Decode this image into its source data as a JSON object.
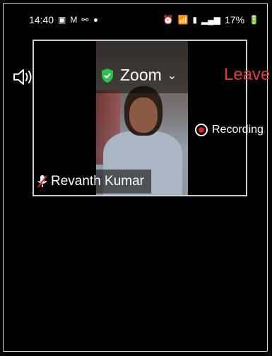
{
  "status_bar": {
    "time": "14:40",
    "battery": "17%",
    "icons": [
      "image-icon",
      "m-icon",
      "app-icon",
      "dot-icon",
      "alarm-icon",
      "wifi-icon",
      "volte-icon",
      "signal-icon",
      "battery-charging-icon"
    ]
  },
  "header": {
    "app_title": "Zoom",
    "leave_label": "Leave",
    "colors": {
      "leave": "#e23b3b",
      "shield": "#2fbf4f"
    }
  },
  "meeting": {
    "recording_label": "Recording",
    "participant_name": "Revanth Kumar"
  }
}
